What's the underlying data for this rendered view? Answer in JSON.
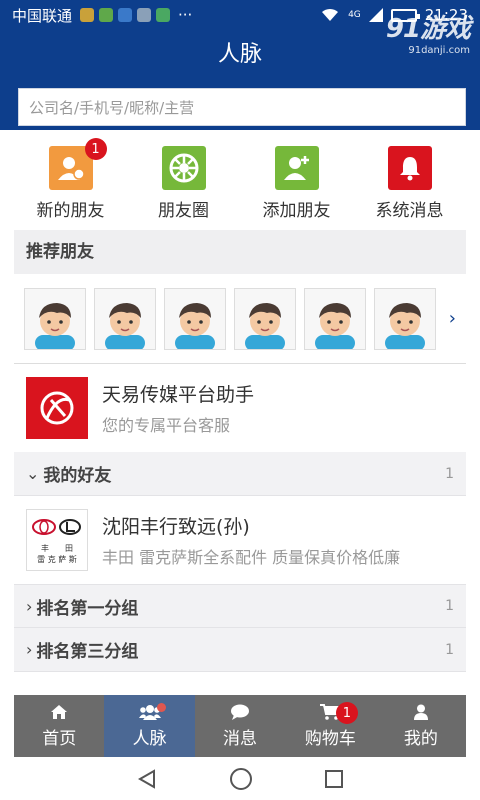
{
  "status_bar": {
    "carrier": "中国联通",
    "network": "4G",
    "time": "21:23",
    "more": "···"
  },
  "watermark": {
    "brand": "91游戏",
    "url": "91danji.com"
  },
  "header": {
    "title": "人脉"
  },
  "search": {
    "placeholder": "公司名/手机号/昵称/主营"
  },
  "quick_actions": [
    {
      "label": "新的朋友",
      "icon": "new-friend-icon",
      "color": "#f29a3f",
      "badge": "1"
    },
    {
      "label": "朋友圈",
      "icon": "moments-icon",
      "color": "#76b83a"
    },
    {
      "label": "添加朋友",
      "icon": "add-friend-icon",
      "color": "#76b83a"
    },
    {
      "label": "系统消息",
      "icon": "bell-icon",
      "color": "#d9141e"
    }
  ],
  "recommended": {
    "title": "推荐朋友",
    "avatar_count": 6
  },
  "assistant": {
    "name": "天易传媒平台助手",
    "subtitle": "您的专属平台客服"
  },
  "my_friends": {
    "title": "我的好友",
    "count": "1"
  },
  "friend": {
    "name": "沈阳丰行致远(孙)",
    "subtitle": "丰田 雷克萨斯全系配件 质量保真价格低廉",
    "logo_text": [
      "丰　　田",
      "雷 克 萨 斯"
    ]
  },
  "groups": [
    {
      "title": "排名第一分组",
      "count": "1"
    },
    {
      "title": "排名第三分组",
      "count": "1"
    }
  ],
  "tabs": [
    {
      "label": "首页",
      "icon": "home-icon"
    },
    {
      "label": "人脉",
      "icon": "contacts-icon",
      "active": true
    },
    {
      "label": "消息",
      "icon": "chat-icon"
    },
    {
      "label": "购物车",
      "icon": "cart-icon",
      "badge": "1"
    },
    {
      "label": "我的",
      "icon": "user-icon"
    }
  ],
  "colors": {
    "primary": "#0d3e8c",
    "tab_bar": "#6b6b6b",
    "tab_active": "#4b6894",
    "badge": "#d9141e"
  }
}
